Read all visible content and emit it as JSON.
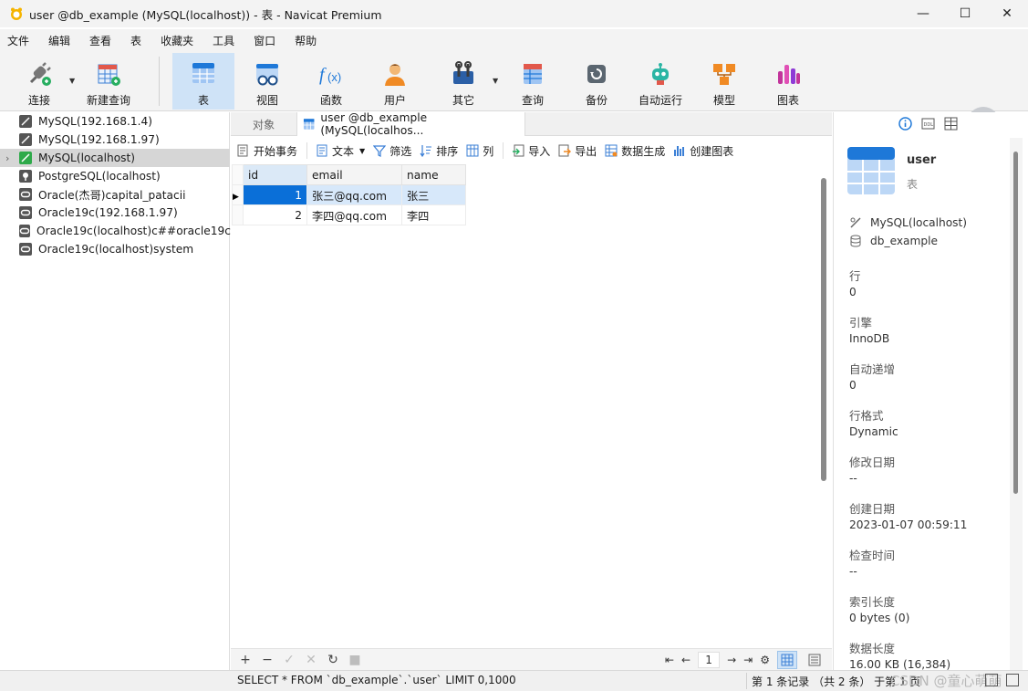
{
  "window": {
    "title": "user @db_example (MySQL(localhost)) - 表 - Navicat Premium",
    "controls": [
      "—",
      "☐",
      "✕"
    ]
  },
  "menu": [
    "文件",
    "编辑",
    "查看",
    "表",
    "收藏夹",
    "工具",
    "窗口",
    "帮助"
  ],
  "toolbar": {
    "connect": "连接",
    "new_query": "新建查询",
    "table": "表",
    "view": "视图",
    "function": "函数",
    "user": "用户",
    "other": "其它",
    "query": "查询",
    "backup": "备份",
    "automation": "自动运行",
    "model": "模型",
    "chart": "图表",
    "active": "表",
    "colors": {
      "active_bg": "#cfe3f7",
      "accent": "#1e88e5"
    }
  },
  "sidebar": {
    "connections": [
      {
        "label": "MySQL(192.168.1.4)",
        "type": "mysql",
        "selected": false
      },
      {
        "label": "MySQL(192.168.1.97)",
        "type": "mysql",
        "selected": false
      },
      {
        "label": "MySQL(localhost)",
        "type": "mysql-open",
        "selected": true
      },
      {
        "label": "PostgreSQL(localhost)",
        "type": "postgres",
        "selected": false
      },
      {
        "label": "Oracle(杰哥)capital_patacii",
        "type": "oracle",
        "selected": false
      },
      {
        "label": "Oracle19c(192.168.1.97)",
        "type": "oracle",
        "selected": false
      },
      {
        "label": "Oracle19c(localhost)c##oracle19c",
        "type": "oracle",
        "selected": false
      },
      {
        "label": "Oracle19c(localhost)system",
        "type": "oracle",
        "selected": false
      }
    ]
  },
  "tabs": {
    "objects": "对象",
    "current": "user @db_example (MySQL(localhos..."
  },
  "subtoolbar": {
    "begin_tx": "开始事务",
    "text": "文本",
    "filter": "筛选",
    "sort": "排序",
    "columns": "列",
    "import": "导入",
    "export": "导出",
    "datagen": "数据生成",
    "create_chart": "创建图表"
  },
  "grid": {
    "columns": [
      "id",
      "email",
      "name"
    ],
    "rows": [
      {
        "id": "1",
        "email": "张三@qq.com",
        "name": "张三",
        "selected": true
      },
      {
        "id": "2",
        "email": "李四@qq.com",
        "name": "李四",
        "selected": false
      }
    ],
    "colors": {
      "selected_cell": "#0a6fd8",
      "selected_row": "#d7e8fa"
    }
  },
  "bottombar": {
    "add": "+",
    "remove": "−",
    "apply": "✓",
    "discard": "✕",
    "refresh": "↻",
    "stop": "■",
    "page": "1"
  },
  "status": {
    "sql": "SELECT * FROM `db_example`.`user` LIMIT 0,1000",
    "records": "第 1 条记录 （共 2 条） 于第 1 页",
    "watermark": "CSDN @童心萌萌"
  },
  "info_panel": {
    "name": "user",
    "type": "表",
    "connection": "MySQL(localhost)",
    "database": "db_example",
    "fields": [
      {
        "label": "行",
        "value": "0"
      },
      {
        "label": "引擎",
        "value": "InnoDB"
      },
      {
        "label": "自动递增",
        "value": "0"
      },
      {
        "label": "行格式",
        "value": "Dynamic"
      },
      {
        "label": "修改日期",
        "value": "--"
      },
      {
        "label": "创建日期",
        "value": "2023-01-07 00:59:11"
      },
      {
        "label": "检查时间",
        "value": "--"
      },
      {
        "label": "索引长度",
        "value": "0 bytes (0)"
      },
      {
        "label": "数据长度",
        "value": "16.00 KB (16,384)"
      }
    ]
  }
}
